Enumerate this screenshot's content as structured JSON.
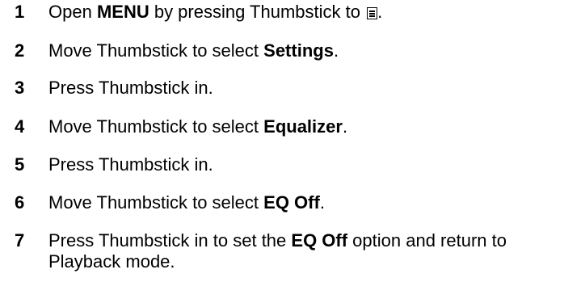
{
  "steps": [
    {
      "number": "1",
      "parts": {
        "a": "Open ",
        "b": "MENU",
        "c": " by pressing Thumbstick to ",
        "d": "."
      },
      "icon": "menu-list-icon"
    },
    {
      "number": "2",
      "parts": {
        "a": "Move Thumbstick to select ",
        "b": "Settings",
        "c": "."
      }
    },
    {
      "number": "3",
      "parts": {
        "a": "Press Thumbstick in."
      }
    },
    {
      "number": "4",
      "parts": {
        "a": "Move Thumbstick to select ",
        "b": "Equalizer",
        "c": "."
      }
    },
    {
      "number": "5",
      "parts": {
        "a": "Press Thumbstick in."
      }
    },
    {
      "number": "6",
      "parts": {
        "a": "Move Thumbstick to select ",
        "b": "EQ Off",
        "c": "."
      }
    },
    {
      "number": "7",
      "parts": {
        "a": "Press Thumbstick in to set the ",
        "b": "EQ Off",
        "c": " option and return to Playback mode."
      }
    }
  ]
}
